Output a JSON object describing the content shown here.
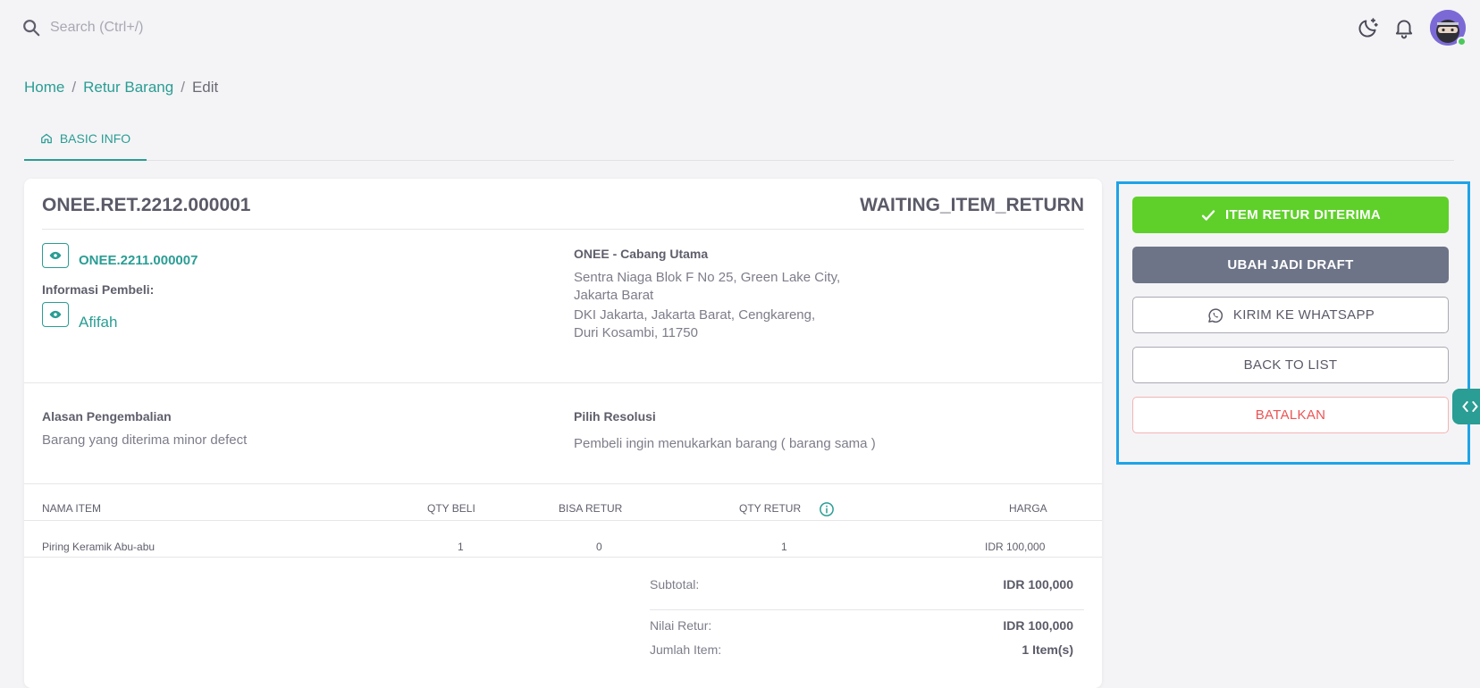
{
  "search": {
    "placeholder": "Search (Ctrl+/)"
  },
  "header": {
    "icons": [
      "moon-star-icon",
      "bell-icon",
      "avatar"
    ]
  },
  "breadcrumb": {
    "home": "Home",
    "section": "Retur Barang",
    "current": "Edit",
    "separator": "/"
  },
  "tabs": [
    {
      "label": "BASIC INFO",
      "icon": "home-icon",
      "active": true
    }
  ],
  "retur": {
    "number": "ONEE.RET.2212.000001",
    "status": "WAITING_ITEM_RETURN",
    "order_number": "ONEE.2211.000007",
    "buyer_label": "Informasi Pembeli:",
    "buyer_name": "Afifah",
    "branch_name": "ONEE - Cabang Utama",
    "address_line1": "Sentra Niaga Blok F No 25, Green Lake City,",
    "address_line2": "Jakarta Barat",
    "address_line3": "DKI Jakarta, Jakarta Barat, Cengkareng,",
    "address_line4": "Duri Kosambi, 11750",
    "reason_label": "Alasan Pengembalian",
    "reason_value": "Barang yang diterima minor defect",
    "resolution_label": "Pilih Resolusi",
    "resolution_value": "Pembeli ingin menukarkan barang ( barang sama )"
  },
  "table": {
    "headers": {
      "name": "NAMA ITEM",
      "qty_buy": "QTY BELI",
      "can_return": "BISA RETUR",
      "qty_return": "QTY RETUR",
      "price": "HARGA"
    },
    "rows": [
      {
        "name": "Piring Keramik Abu-abu",
        "qty_buy": "1",
        "can_return": "0",
        "qty_return": "1",
        "price": "IDR 100,000"
      }
    ]
  },
  "summary": {
    "subtotal_label": "Subtotal:",
    "subtotal_value": "IDR 100,000",
    "return_value_label": "Nilai Retur:",
    "return_value": "IDR 100,000",
    "item_count_label": "Jumlah Item:",
    "item_count": "1 Item(s)"
  },
  "actions": {
    "accept": "ITEM RETUR DITERIMA",
    "draft": "UBAH JADI DRAFT",
    "whatsapp": "KIRIM KE WHATSAPP",
    "back": "BACK TO LIST",
    "cancel": "BATALKAN"
  },
  "colors": {
    "primary": "#2a9d94",
    "success": "#5fd02a",
    "secondary": "#6d7487",
    "danger": "#ea5455",
    "highlight": "#1ea3e8"
  }
}
